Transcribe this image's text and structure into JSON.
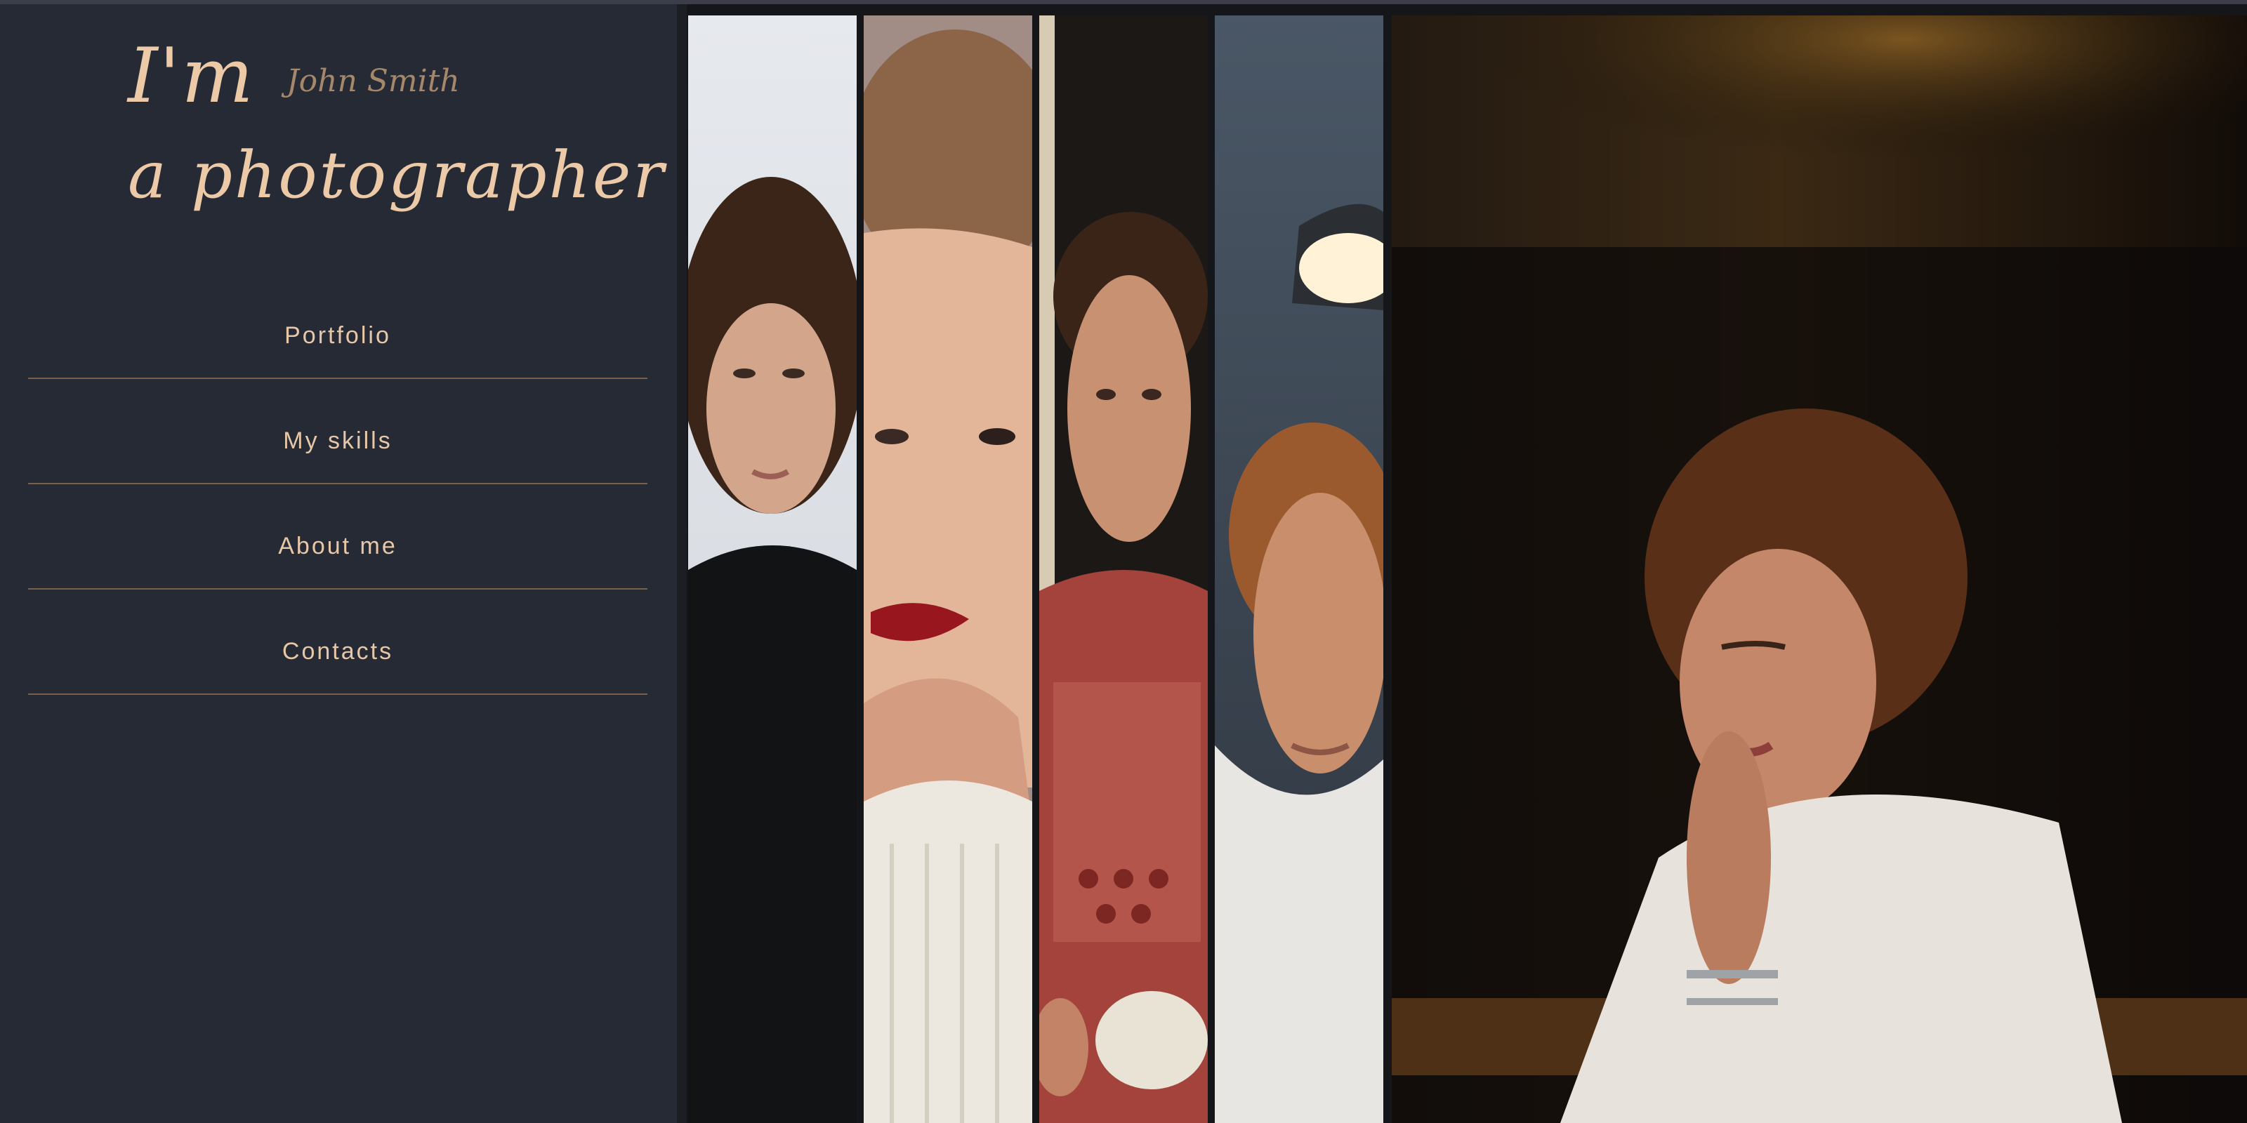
{
  "brand": {
    "line1": "I'm",
    "name": "John Smith",
    "line2": "a photographer"
  },
  "menu": {
    "items": [
      {
        "label": "Portfolio"
      },
      {
        "label": "My skills"
      },
      {
        "label": "About me"
      },
      {
        "label": "Contacts"
      }
    ]
  },
  "colors": {
    "sidebar_bg": "#262a35",
    "accent_text": "#ecc9a7",
    "menu_divider": "#7a6049"
  }
}
